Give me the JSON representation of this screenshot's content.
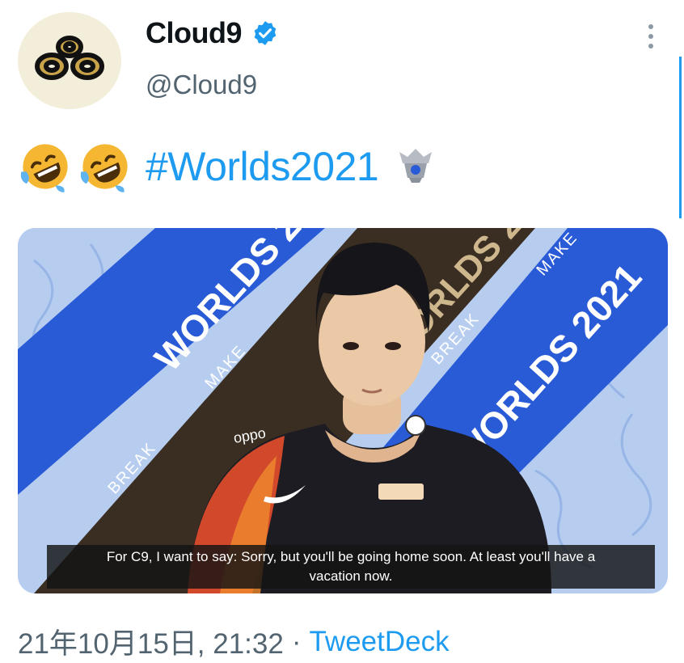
{
  "user": {
    "display_name": "Cloud9",
    "handle": "@Cloud9",
    "verified_icon": "verified-badge-icon",
    "avatar_icon": "cloud9-logo-icon"
  },
  "tweet": {
    "emojis": [
      "rolling-on-floor-laughing-emoji",
      "rolling-on-floor-laughing-emoji"
    ],
    "hashtag": "#Worlds2021",
    "hashtag_icon": "worlds-trophy-icon"
  },
  "media": {
    "banner_text": "WORLDS 2021",
    "banner_words": [
      "BREAK",
      "MAKE"
    ],
    "jersey_text": "oppo",
    "caption_line1": "For C9, I want to say: Sorry, but you'll be going home soon. At least you'll have a",
    "caption_line2": "vacation now."
  },
  "footer": {
    "timestamp": "21年10月15日, 21:32",
    "separator": "·",
    "source": "TweetDeck"
  },
  "colors": {
    "link_blue": "#1d9bf0",
    "secondary_text": "#536471",
    "banner_blue": "#2a5bd7",
    "banner_dark": "#3a2e22"
  }
}
